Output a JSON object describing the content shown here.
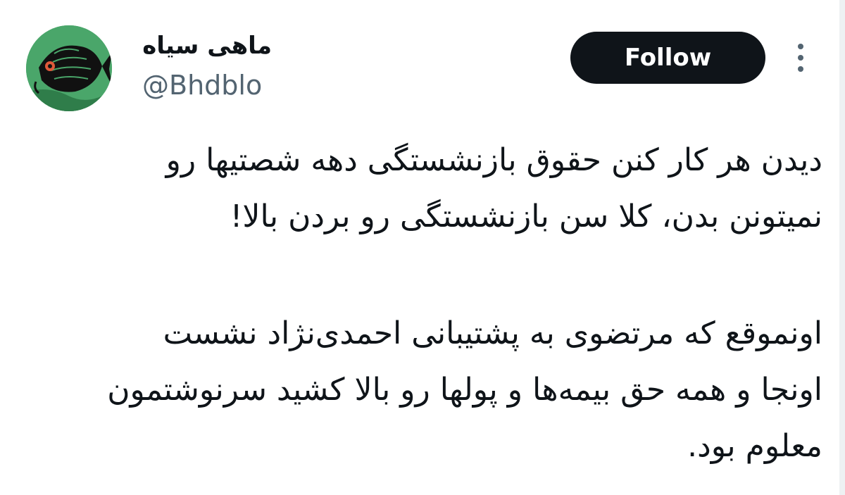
{
  "author": {
    "display_name": "ماهی سیاه",
    "handle": "@Bhdblo",
    "avatar_icon": "black-fish-illustration"
  },
  "actions": {
    "follow_label": "Follow",
    "more_icon": "more-vertical-icon"
  },
  "tweet": {
    "paragraph1": {
      "line1": "دیدن هر کار کنن حقوق بازنشستگی دهه شصتیها رو",
      "line2": "نمیتونن بدن، کلا سن بازنشستگی رو بردن بالا!"
    },
    "paragraph2": {
      "line1": "اونموقع که مرتضوی به پشتیبانی احمدی‌نژاد نشست",
      "line2": "اونجا و همه حق بیمه‌ها و پولها رو بالا کشید سرنوشتمون",
      "line3": "معلوم بود."
    }
  },
  "colors": {
    "text": "#0f1419",
    "secondary": "#536471",
    "button_bg": "#0f1419",
    "button_text": "#ffffff",
    "avatar_bg": "#4aa66a"
  }
}
